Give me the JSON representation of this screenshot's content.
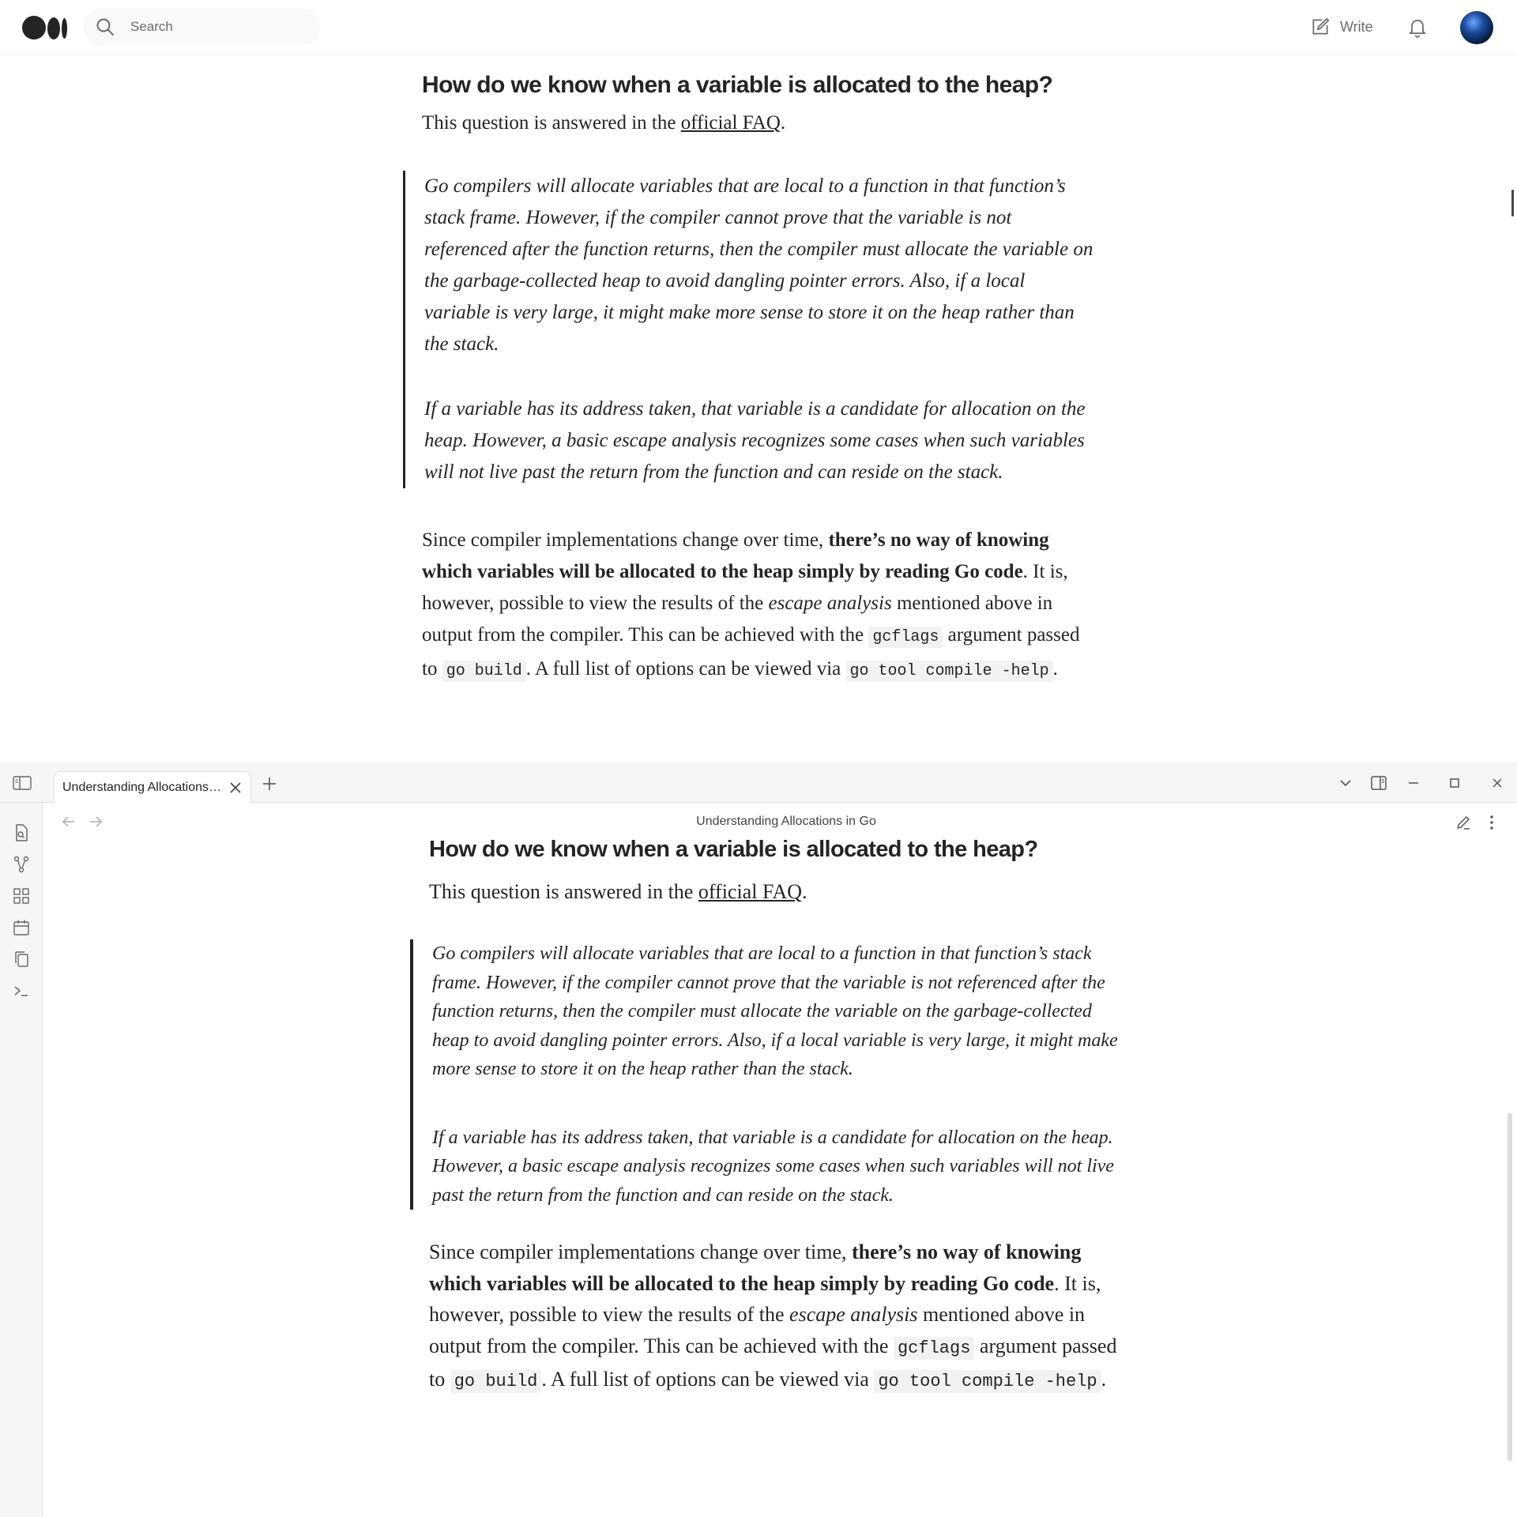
{
  "medium": {
    "search_placeholder": "Search",
    "write_label": "Write"
  },
  "article": {
    "heading": "How do we know when a variable is allocated to the heap?",
    "lead_text": "This question is answered in the ",
    "lead_link": "official FAQ",
    "lead_end": ".",
    "quote_1": "Go compilers will allocate variables that are local to a function in that function’s stack frame. However, if the compiler cannot prove that the variable is not referenced after the function returns, then the compiler must allocate the variable on the garbage-collected heap to avoid dangling pointer errors. Also, if a local variable is very large, it might make more sense to store it on the heap rather than the stack.",
    "quote_2": "If a variable has its address taken, that variable is a candidate for allocation on the heap. However, a basic escape analysis recognizes some cases when such variables will not live past the return from the function and can reside on the stack.",
    "body_1": "Since compiler implementations change over time, ",
    "body_bold": "there’s no way of knowing which variables will be allocated to the heap simply by reading Go code",
    "body_2": ". It is, however, possible to view the results of the ",
    "body_italic": "escape analysis",
    "body_3": " mentioned above in output from the compiler. This can be achieved with the ",
    "code_1": "gcflags",
    "body_4": " argument passed to ",
    "code_2": "go build",
    "body_5": ". A full list of options can be viewed via ",
    "code_3": "go tool compile -help",
    "body_6": "."
  },
  "obsidian": {
    "tab_title": "Understanding Allocations…",
    "view_title": "Understanding Allocations in Go"
  },
  "colors": {
    "text": "#242424",
    "code_bg": "#f2f2f2",
    "chrome_bg": "#f6f6f6"
  }
}
